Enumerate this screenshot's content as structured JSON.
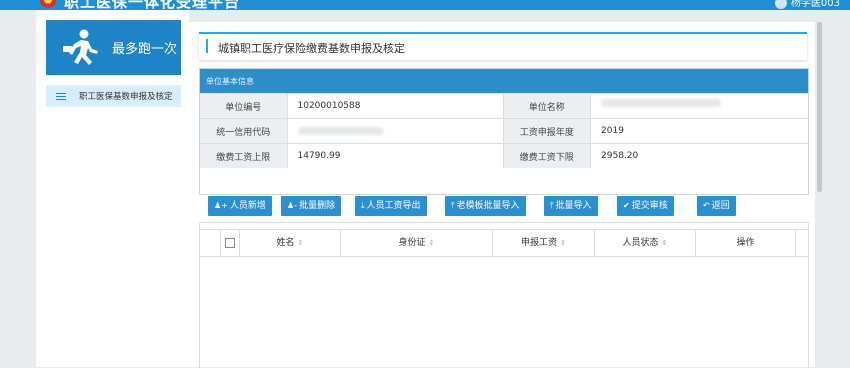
{
  "header": {
    "app_title": "职工医保一体化受理平台",
    "user_name": "杨学医003"
  },
  "sidebar": {
    "logo_text": "最多跑一次",
    "items": [
      {
        "label": "职工医保基数申报及核定",
        "icon": "list-icon"
      }
    ]
  },
  "page": {
    "title": "城镇职工医疗保险缴费基数申报及核定"
  },
  "unit_info": {
    "section_title": "单位基本信息",
    "rows": [
      {
        "label1": "单位编号",
        "value1": "10200010588",
        "label2": "单位名称",
        "value2": ""
      },
      {
        "label1": "统一信用代码",
        "value1": "",
        "label2": "工资申报年度",
        "value2": "2019"
      },
      {
        "label1": "缴费工资上限",
        "value1": "14790.99",
        "label2": "缴费工资下限",
        "value2": "2958.20"
      }
    ]
  },
  "toolbar": {
    "add_person": "人员新增",
    "batch_delete": "批量删除",
    "export_wages": "人员工资导出",
    "old_template_import": "老模板批量导入",
    "batch_import": "批量导入",
    "submit_review": "提交审核",
    "back": "返回"
  },
  "table": {
    "columns": [
      "姓名",
      "身份证",
      "申报工资",
      "人员状态",
      "操作"
    ],
    "rows": []
  },
  "colors": {
    "primary": "#2b8fd0",
    "header_bar": "#1f8fd6",
    "sidebar_active": "#d7eefa"
  }
}
